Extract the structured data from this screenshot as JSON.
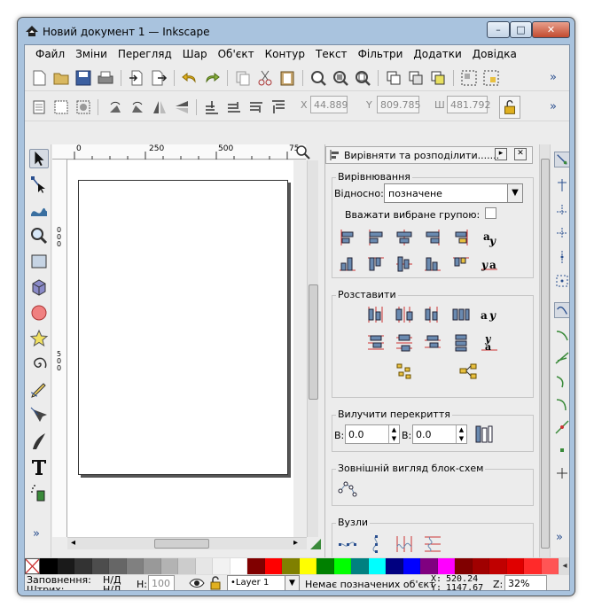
{
  "window": {
    "title": "Новий документ 1 — Inkscape",
    "min": "–",
    "max": "□",
    "close": "✕"
  },
  "menu": [
    "Файл",
    "Зміни",
    "Перегляд",
    "Шар",
    "Об'єкт",
    "Контур",
    "Текст",
    "Фільтри",
    "Додатки",
    "Довідка"
  ],
  "more": "»",
  "coords": {
    "x_label": "X",
    "x": "44.889",
    "y_label": "Y",
    "y": "809.785",
    "w_label": "Ш",
    "w": "481.792"
  },
  "ruler": {
    "h": [
      "0",
      "250",
      "500",
      "75"
    ],
    "v": [
      "0",
      "0",
      "0",
      "5",
      "0",
      "0",
      "5",
      "0",
      "0"
    ]
  },
  "panel": {
    "title": "Вирівняти та розподілити.......",
    "align_title": "Вирівнювання",
    "relative_label": "Відносно:",
    "relative_value": "позначене",
    "group_label": "Вважати вибране групою:",
    "distribute_title": "Розставити",
    "overlap_title": "Вилучити перекриття",
    "h_label": "В:",
    "h_value": "0.0",
    "v_label": "В:",
    "v_value": "0.0",
    "graph_title": "Зовнішній вигляд блок-схем",
    "nodes_title": "Вузли"
  },
  "palette": [
    "#000000",
    "#1a1a1a",
    "#333333",
    "#4d4d4d",
    "#666666",
    "#808080",
    "#999999",
    "#b3b3b3",
    "#cccccc",
    "#e6e6e6",
    "#f2f2f2",
    "#ffffff",
    "#800000",
    "#ff0000",
    "#808000",
    "#ffff00",
    "#008000",
    "#00ff00",
    "#008080",
    "#00ffff",
    "#000080",
    "#0000ff",
    "#800080",
    "#ff00ff",
    "#800000",
    "#a00000",
    "#c00000",
    "#e00000",
    "#ff2a2a",
    "#ff5555"
  ],
  "status": {
    "fill_label": "Заповнення:",
    "fill_value": "Н/Д",
    "stroke_label": "Штрих:",
    "stroke_value": "Н/Д",
    "h_label": "Н:",
    "h_value": "100",
    "layer": "•Layer 1",
    "message": "Немає позначених об'єкт",
    "x_label": "X:",
    "x": "520.24",
    "y_label": "Y:",
    "y": "1147.67",
    "zoom_label": "Z:",
    "zoom": "32%"
  }
}
